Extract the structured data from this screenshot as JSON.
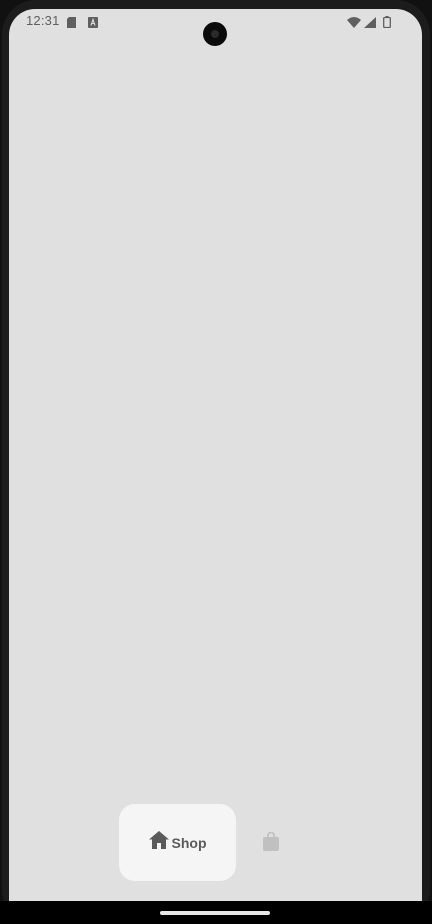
{
  "status_bar": {
    "time": "12:31",
    "left_icons": [
      "sd-card-icon",
      "a-notification-icon"
    ],
    "right_icons": [
      "wifi-icon",
      "signal-icon",
      "battery-icon"
    ]
  },
  "bottom_nav": {
    "items": [
      {
        "label": "Shop",
        "icon": "home-icon",
        "selected": true
      },
      {
        "label": "",
        "icon": "shopping-bag-icon",
        "selected": false
      }
    ]
  },
  "colors": {
    "screen_bg": "#e0e0e0",
    "nav_selected_bg": "#f5f5f5",
    "nav_selected_fg": "#5a5a5a",
    "nav_unselected_fg": "#c0c0c0",
    "status_fg": "#5f5f5f"
  }
}
